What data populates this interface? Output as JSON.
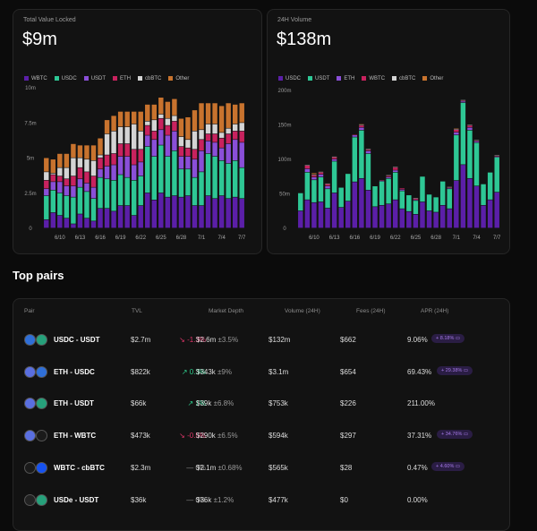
{
  "tvl": {
    "title": "Total Value Locked",
    "value": "$9m"
  },
  "volume": {
    "title": "24H Volume",
    "value": "$138m"
  },
  "top_pairs": {
    "title": "Top pairs",
    "headers": [
      "Pair",
      "TVL",
      "Market Depth",
      "Volume (24H)",
      "Fees (24H)",
      "APR (24H)"
    ],
    "rows": [
      {
        "pair": "USDC - USDT",
        "t0": "USDC",
        "t1": "USDT",
        "tvl": "$2.7m",
        "change": "↘ -1.3%",
        "dir": "down",
        "depth": "$2.6m",
        "depth_pct": "±3.5%",
        "volume": "$132m",
        "fees": "$662",
        "apr": "9.06%",
        "badge": "+ 8.18% ▭"
      },
      {
        "pair": "ETH - USDC",
        "t0": "ETH",
        "t1": "USDC",
        "tvl": "$822k",
        "change": "↗ 0.3%",
        "dir": "up",
        "depth": "$343k",
        "depth_pct": "±9%",
        "volume": "$3.1m",
        "fees": "$654",
        "apr": "69.43%",
        "badge": "+ 29.38% ▭"
      },
      {
        "pair": "ETH - USDT",
        "t0": "ETH",
        "t1": "USDT",
        "tvl": "$66k",
        "change": "↗ 1%",
        "dir": "up",
        "depth": "$39k",
        "depth_pct": "±6.8%",
        "volume": "$753k",
        "fees": "$226",
        "apr": "211.00%",
        "badge": ""
      },
      {
        "pair": "ETH - WBTC",
        "t0": "ETH",
        "t1": "WBTC",
        "tvl": "$473k",
        "change": "↘ -0.5%",
        "dir": "down",
        "depth": "$290k",
        "depth_pct": "±6.5%",
        "volume": "$594k",
        "fees": "$297",
        "apr": "37.31%",
        "badge": "+ 34.76% ▭"
      },
      {
        "pair": "WBTC - cbBTC",
        "t0": "WBTC",
        "t1": "cbBTC",
        "tvl": "$2.3m",
        "change": "— 0%",
        "dir": "flat",
        "depth": "$2.1m",
        "depth_pct": "±0.68%",
        "volume": "$565k",
        "fees": "$28",
        "apr": "0.47%",
        "badge": "+ 4.60% ▭"
      },
      {
        "pair": "USDe - USDT",
        "t0": "USDe",
        "t1": "USDT",
        "tvl": "$36k",
        "change": "— 0%",
        "dir": "flat",
        "depth": "$36k",
        "depth_pct": "±1.2%",
        "volume": "$477k",
        "fees": "$0",
        "apr": "0.00%",
        "badge": ""
      }
    ]
  },
  "colors": {
    "up": "#2fd18f",
    "down": "#e0366a",
    "token_USDC": "#2f6fd8",
    "token_USDT": "#26a17b",
    "token_ETH": "#5a6fe0",
    "token_WBTC": "#1a1a1a",
    "token_cbBTC": "#1652f0",
    "token_USDe": "#222"
  },
  "chart_data": [
    {
      "type": "bar",
      "stacked": true,
      "title": "Total Value Locked",
      "ylim": [
        0,
        10
      ],
      "yticks": [
        "0",
        "2.5m",
        "5m",
        "7.5m",
        "10m"
      ],
      "ytick_values": [
        0,
        2.5,
        5,
        7.5,
        10
      ],
      "categories": [
        "6/8",
        "6/9",
        "6/10",
        "6/11",
        "6/12",
        "6/13",
        "6/14",
        "6/15",
        "6/16",
        "6/17",
        "6/18",
        "6/19",
        "6/20",
        "6/21",
        "6/22",
        "6/23",
        "6/24",
        "6/25",
        "6/26",
        "6/27",
        "6/28",
        "6/29",
        "6/30",
        "7/1",
        "7/2",
        "7/3",
        "7/4",
        "7/5",
        "7/6",
        "7/7"
      ],
      "xticks": [
        "6/10",
        "6/13",
        "6/16",
        "6/19",
        "6/22",
        "6/25",
        "6/28",
        "7/1",
        "7/4",
        "7/7"
      ],
      "series": [
        {
          "name": "WBTC",
          "color": "#5b1fa8",
          "values": [
            0.6,
            1.1,
            0.9,
            0.7,
            0.3,
            1.0,
            0.7,
            0.5,
            1.4,
            1.4,
            1.2,
            1.6,
            1.6,
            0.9,
            1.6,
            2.5,
            2.0,
            2.5,
            2.2,
            2.3,
            2.2,
            2.3,
            1.6,
            1.6,
            2.3,
            2.1,
            2.3,
            2.1,
            2.2,
            2.1
          ]
        },
        {
          "name": "USDC",
          "color": "#2ec795",
          "values": [
            1.7,
            1.6,
            1.6,
            1.6,
            1.9,
            1.9,
            1.9,
            1.6,
            2.2,
            2.1,
            2.2,
            2.2,
            2.0,
            2.5,
            2.1,
            3.3,
            3.1,
            3.4,
            2.9,
            3.2,
            2.0,
            1.9,
            2.0,
            2.4,
            3.0,
            3.0,
            2.5,
            2.5,
            2.6,
            2.2
          ]
        },
        {
          "name": "USDT",
          "color": "#8a4fd8",
          "values": [
            0.5,
            0.6,
            0.8,
            0.7,
            0.8,
            0.6,
            0.6,
            0.8,
            0.6,
            0.9,
            1.1,
            1.3,
            1.5,
            1.1,
            1.0,
            0.8,
            1.2,
            1.1,
            1.5,
            1.4,
            0.9,
            0.9,
            1.3,
            1.5,
            0.9,
            1.0,
            0.9,
            1.4,
            1.5,
            1.8
          ]
        },
        {
          "name": "ETH",
          "color": "#c8225e",
          "values": [
            0.6,
            0.5,
            0.4,
            0.5,
            0.7,
            0.8,
            0.8,
            0.8,
            0.8,
            0.8,
            0.8,
            0.9,
            0.9,
            1.1,
            0.9,
            0.7,
            0.6,
            0.8,
            0.7,
            0.7,
            0.7,
            0.6,
            0.7,
            0.8,
            0.5,
            0.6,
            0.7,
            0.7,
            0.6,
            0.8
          ]
        },
        {
          "name": "cbBTC",
          "color": "#d4d4d4",
          "values": [
            0.6,
            0.1,
            0.6,
            0.8,
            1.3,
            0.7,
            0.9,
            1.1,
            0.2,
            1.5,
            1.6,
            1.2,
            1.2,
            1.8,
            1.3,
            0.3,
            0.8,
            0.3,
            0.5,
            0.4,
            0.7,
            0.6,
            1.3,
            0.7,
            0.7,
            0.7,
            0.4,
            0.4,
            0.5,
            0.6
          ]
        },
        {
          "name": "Other",
          "color": "#c8732e",
          "values": [
            1.0,
            1.0,
            1.0,
            1.0,
            1.0,
            0.9,
            1.0,
            1.1,
            1.2,
            1.0,
            1.1,
            1.1,
            1.1,
            0.9,
            1.4,
            1.2,
            1.1,
            1.2,
            1.2,
            1.2,
            1.3,
            1.6,
            1.5,
            1.9,
            1.5,
            1.5,
            1.9,
            1.8,
            1.4,
            1.4
          ]
        }
      ]
    },
    {
      "type": "bar",
      "stacked": true,
      "title": "24H Volume",
      "ylim": [
        0,
        200
      ],
      "yticks": [
        "0",
        "50m",
        "100m",
        "150m",
        "200m"
      ],
      "ytick_values": [
        0,
        50,
        100,
        150,
        200
      ],
      "categories": [
        "6/8",
        "6/9",
        "6/10",
        "6/11",
        "6/12",
        "6/13",
        "6/14",
        "6/15",
        "6/16",
        "6/17",
        "6/18",
        "6/19",
        "6/20",
        "6/21",
        "6/22",
        "6/23",
        "6/24",
        "6/25",
        "6/26",
        "6/27",
        "6/28",
        "6/29",
        "6/30",
        "7/1",
        "7/2",
        "7/3",
        "7/4",
        "7/5",
        "7/6",
        "7/7"
      ],
      "xticks": [
        "6/10",
        "6/13",
        "6/16",
        "6/19",
        "6/22",
        "6/25",
        "6/28",
        "7/1",
        "7/4",
        "7/7"
      ],
      "series": [
        {
          "name": "USDC",
          "color": "#5b1fa8",
          "values": [
            25,
            41,
            37,
            38,
            29,
            51,
            30,
            39,
            67,
            72,
            55,
            31,
            33,
            35,
            41,
            28,
            24,
            20,
            38,
            25,
            23,
            33,
            28,
            69,
            92,
            72,
            61,
            33,
            41,
            52
          ]
        },
        {
          "name": "USDT",
          "color": "#2ec795",
          "values": [
            26,
            40,
            33,
            36,
            28,
            46,
            29,
            40,
            65,
            70,
            53,
            30,
            35,
            37,
            40,
            26,
            24,
            20,
            37,
            24,
            22,
            35,
            29,
            66,
            90,
            70,
            63,
            31,
            40,
            51
          ]
        },
        {
          "name": "ETH",
          "color": "#8a4fd8",
          "values": [
            0,
            5,
            4,
            4,
            4,
            3,
            0,
            0,
            3,
            4,
            4,
            0,
            1,
            2,
            3,
            2,
            0,
            1,
            0,
            0,
            0,
            0,
            1,
            4,
            2,
            4,
            2,
            0,
            0,
            1
          ]
        },
        {
          "name": "WBTC",
          "color": "#c8225e",
          "values": [
            0,
            5,
            3,
            3,
            3,
            3,
            0,
            0,
            1,
            3,
            2,
            0,
            1,
            2,
            4,
            2,
            0,
            2,
            0,
            0,
            0,
            0,
            1,
            4,
            1,
            3,
            1,
            0,
            0,
            1
          ]
        },
        {
          "name": "cbBTC",
          "color": "#d4d4d4",
          "values": [
            0,
            1,
            1,
            1,
            1,
            1,
            0,
            0,
            0,
            1,
            1,
            0,
            0,
            1,
            1,
            0,
            0,
            1,
            0,
            0,
            0,
            0,
            1,
            1,
            1,
            1,
            1,
            0,
            0,
            1
          ]
        },
        {
          "name": "Other",
          "color": "#c8732e",
          "values": [
            0,
            0,
            2,
            0,
            0,
            0,
            0,
            0,
            0,
            1,
            0,
            0,
            0,
            0,
            0,
            0,
            0,
            0,
            0,
            0,
            0,
            0,
            0,
            1,
            0,
            0,
            0,
            0,
            0,
            0
          ]
        }
      ]
    }
  ]
}
